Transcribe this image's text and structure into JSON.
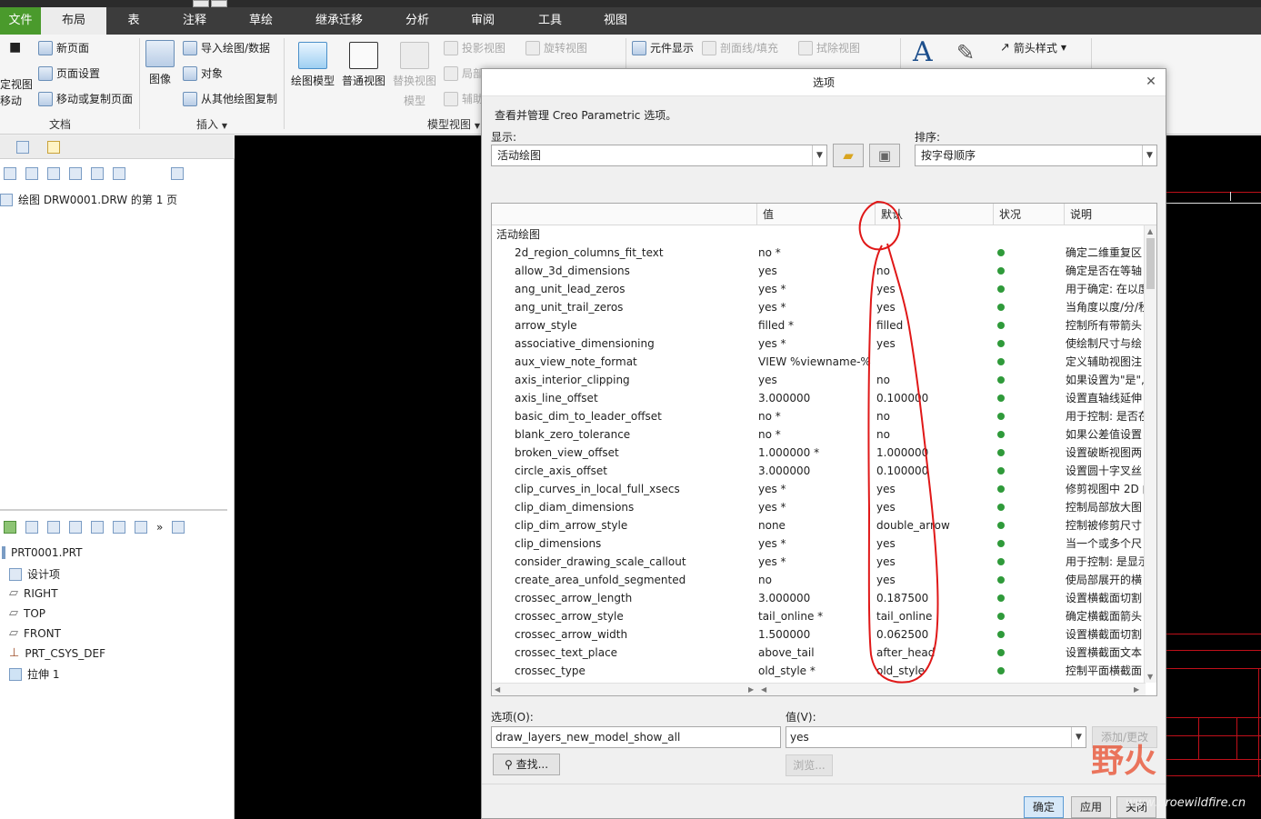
{
  "tabs": [
    "文件",
    "布局",
    "表",
    "注释",
    "草绘",
    "继承迁移",
    "分析",
    "审阅",
    "工具",
    "视图"
  ],
  "ribbon": {
    "doc_group": {
      "partial_left_1": "定视图",
      "partial_left_2": "移动",
      "new_page": "新页面",
      "page_setup": "页面设置",
      "move_copy_page": "移动或复制页面",
      "label": "文档"
    },
    "insert_group": {
      "image": "图像",
      "import_drawing": "导入绘图/数据",
      "object": "对象",
      "copy_from_other": "从其他绘图复制",
      "label": "插入"
    },
    "model_view_group": {
      "drawing_model": "绘图模型",
      "general_view": "普通视图",
      "replace_view_1": "替换视图",
      "replace_view_2": "模型",
      "projection_view": "投影视图",
      "local": "局部",
      "aux": "辅助",
      "rotate_view": "旋转视图",
      "label": "模型视图"
    },
    "edit_group": {
      "element_display": "元件显示",
      "section_fill": "剖面线/填充",
      "erase_view": "拭除视图"
    },
    "format_group": {
      "arrow_style": "箭头样式"
    }
  },
  "left_panel": {
    "drawing_title": "绘图 DRW0001.DRW 的第 1 页",
    "tree": [
      "PRT0001.PRT",
      "设计项",
      "RIGHT",
      "TOP",
      "FRONT",
      "PRT_CSYS_DEF",
      "拉伸 1"
    ]
  },
  "dialog": {
    "title": "选项",
    "description": "查看并管理 Creo Parametric 选项。",
    "show_label": "显示:",
    "show_value": "活动绘图",
    "sort_label": "排序:",
    "sort_value": "按字母顺序",
    "columns": [
      "值",
      "默认",
      "状况",
      "说明"
    ],
    "group_header": "活动绘图",
    "rows": [
      {
        "name": "2d_region_columns_fit_text",
        "value": "no *",
        "default": "",
        "desc": "确定二维重复区"
      },
      {
        "name": "allow_3d_dimensions",
        "value": "yes",
        "default": "no",
        "desc": "确定是否在等轴"
      },
      {
        "name": "ang_unit_lead_zeros",
        "value": "yes *",
        "default": "yes",
        "desc": "用于确定: 在以度"
      },
      {
        "name": "ang_unit_trail_zeros",
        "value": "yes *",
        "default": "yes",
        "desc": "当角度以度/分/秒"
      },
      {
        "name": "arrow_style",
        "value": "filled *",
        "default": "filled",
        "desc": "控制所有带箭头"
      },
      {
        "name": "associative_dimensioning",
        "value": "yes *",
        "default": "yes",
        "desc": "使绘制尺寸与绘"
      },
      {
        "name": "aux_view_note_format",
        "value": "VIEW %viewname-%v",
        "default": "",
        "desc": "定义辅助视图注"
      },
      {
        "name": "axis_interior_clipping",
        "value": "yes",
        "default": "no",
        "desc": "如果设置为\"是\","
      },
      {
        "name": "axis_line_offset",
        "value": "3.000000",
        "default": "0.100000",
        "desc": "设置直轴线延伸"
      },
      {
        "name": "basic_dim_to_leader_offset",
        "value": "no *",
        "default": "no",
        "desc": "用于控制: 是否在"
      },
      {
        "name": "blank_zero_tolerance",
        "value": "no *",
        "default": "no",
        "desc": "如果公差值设置"
      },
      {
        "name": "broken_view_offset",
        "value": "1.000000 *",
        "default": "1.000000",
        "desc": "设置破断视图两"
      },
      {
        "name": "circle_axis_offset",
        "value": "3.000000",
        "default": "0.100000",
        "desc": "设置圆十字叉丝"
      },
      {
        "name": "clip_curves_in_local_full_xsecs",
        "value": "yes *",
        "default": "yes",
        "desc": "修剪视图中 2D 曲"
      },
      {
        "name": "clip_diam_dimensions",
        "value": "yes *",
        "default": "yes",
        "desc": "控制局部放大图"
      },
      {
        "name": "clip_dim_arrow_style",
        "value": "none",
        "default": "double_arrow",
        "desc": "控制被修剪尺寸"
      },
      {
        "name": "clip_dimensions",
        "value": "yes *",
        "default": "yes",
        "desc": "当一个或多个尺"
      },
      {
        "name": "consider_drawing_scale_callout",
        "value": "yes *",
        "default": "yes",
        "desc": "用于控制: 是显示"
      },
      {
        "name": "create_area_unfold_segmented",
        "value": "no",
        "default": "yes",
        "desc": "使局部展开的横"
      },
      {
        "name": "crossec_arrow_length",
        "value": "3.000000",
        "default": "0.187500",
        "desc": "设置横截面切割"
      },
      {
        "name": "crossec_arrow_style",
        "value": "tail_online *",
        "default": "tail_online",
        "desc": "确定横截面箭头"
      },
      {
        "name": "crossec_arrow_width",
        "value": "1.500000",
        "default": "0.062500",
        "desc": "设置横截面切割"
      },
      {
        "name": "crossec_text_place",
        "value": "above_tail",
        "default": "after_head",
        "desc": "设置横截面文本"
      },
      {
        "name": "crossec_type",
        "value": "old_style *",
        "default": "old_style",
        "desc": "控制平面横截面"
      }
    ],
    "option_label": "选项(O):",
    "option_value": "draw_layers_new_model_show_all",
    "value_label": "值(V):",
    "value_value": "yes",
    "add_change": "添加/更改",
    "find": "查找...",
    "browse": "浏览...",
    "ok": "确定",
    "apply": "应用",
    "close": "关闭"
  },
  "watermark": {
    "text": "野火",
    "url": "www.proewildfire.cn"
  },
  "colors": {
    "file_tab": "#4a9a2c",
    "status_ok": "#2f9a3a",
    "annotation": "#e01818"
  }
}
